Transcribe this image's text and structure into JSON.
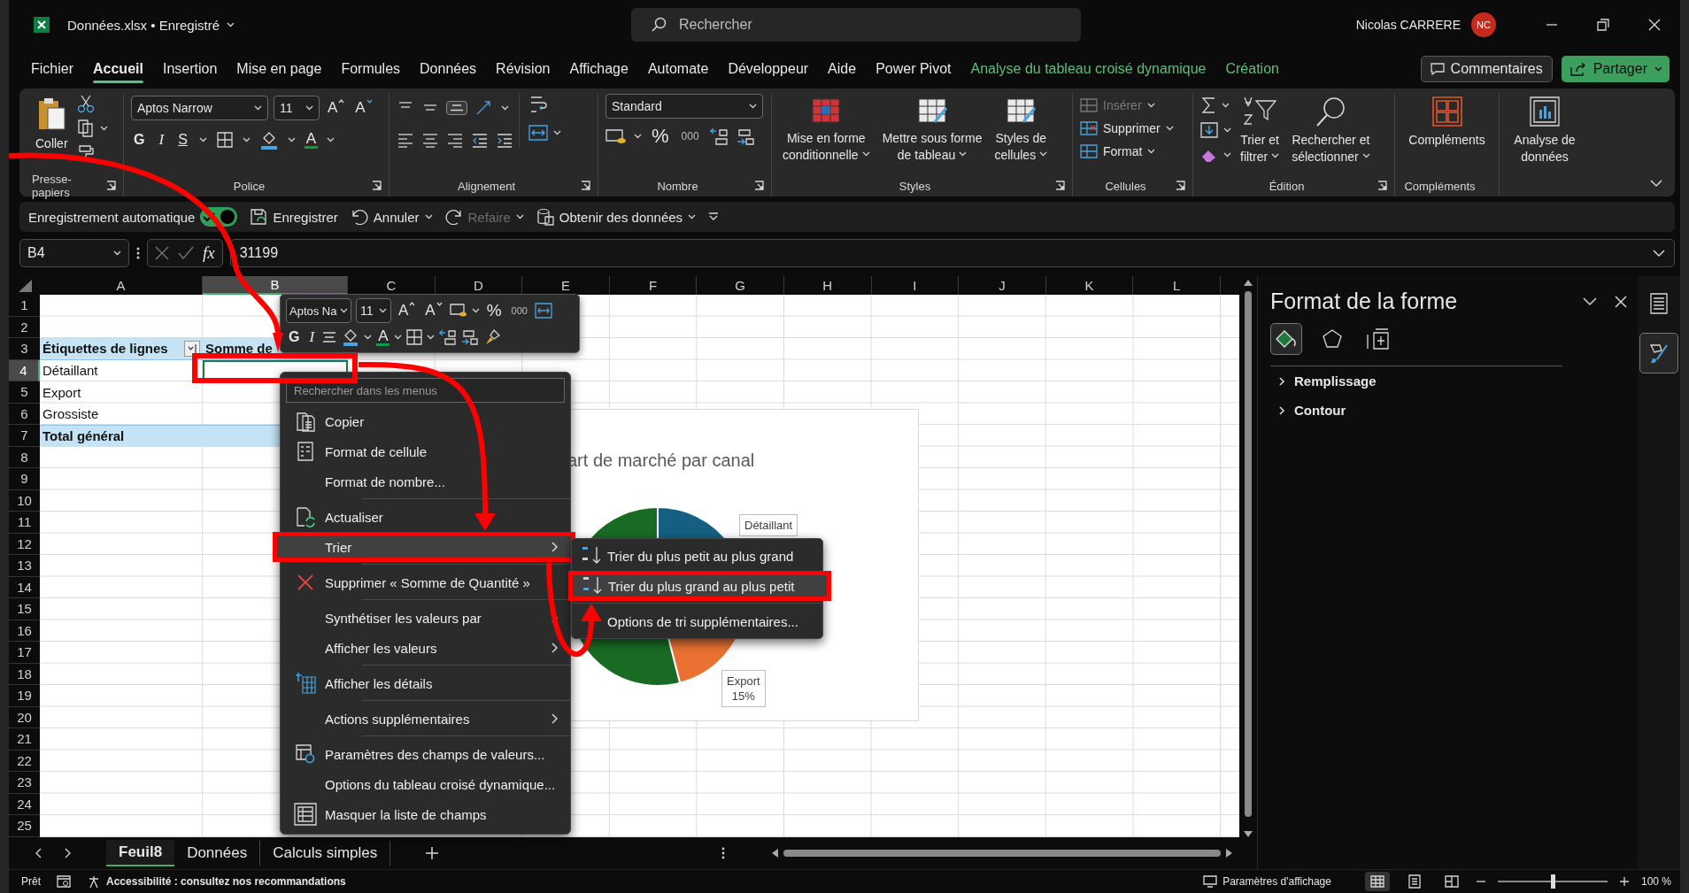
{
  "window": {
    "title": "Données.xlsx • Enregistré",
    "search": {
      "placeholder": "Rechercher"
    },
    "user": "Nicolas CARRERE",
    "avatar": "NC"
  },
  "menu_tabs": [
    {
      "label": "Fichier",
      "selected": false,
      "kind": "normal"
    },
    {
      "label": "Accueil",
      "selected": true,
      "kind": "normal"
    },
    {
      "label": "Insertion",
      "selected": false,
      "kind": "normal"
    },
    {
      "label": "Mise en page",
      "selected": false,
      "kind": "normal"
    },
    {
      "label": "Formules",
      "selected": false,
      "kind": "normal"
    },
    {
      "label": "Données",
      "selected": false,
      "kind": "normal"
    },
    {
      "label": "Révision",
      "selected": false,
      "kind": "normal"
    },
    {
      "label": "Affichage",
      "selected": false,
      "kind": "normal"
    },
    {
      "label": "Automate",
      "selected": false,
      "kind": "normal"
    },
    {
      "label": "Développeur",
      "selected": false,
      "kind": "normal"
    },
    {
      "label": "Aide",
      "selected": false,
      "kind": "normal"
    },
    {
      "label": "Power Pivot",
      "selected": false,
      "kind": "normal"
    },
    {
      "label": "Analyse du tableau croisé dynamique",
      "selected": false,
      "kind": "contextual"
    },
    {
      "label": "Création",
      "selected": false,
      "kind": "contextual"
    }
  ],
  "comments_button": "Commentaires",
  "share_button": "Partager",
  "ribbon": {
    "clipboard": {
      "label": "Presse-papiers",
      "paste": "Coller"
    },
    "font": {
      "label": "Police",
      "font_name": "Aptos Narrow",
      "font_size": "11",
      "grow": "A",
      "shrink": "A",
      "bold": "G",
      "italic": "I",
      "underline": "S",
      "font_color": "A"
    },
    "alignment": {
      "label": "Alignement"
    },
    "number": {
      "label": "Nombre",
      "format": "Standard",
      "percent": "%",
      "thousands": "000"
    },
    "styles": {
      "label": "Styles",
      "buttons": [
        {
          "lines": [
            "Mise en forme",
            "conditionnelle"
          ]
        },
        {
          "lines": [
            "Mettre sous forme",
            "de tableau"
          ]
        },
        {
          "lines": [
            "Styles de",
            "cellules"
          ]
        }
      ]
    },
    "cells": {
      "label": "Cellules",
      "items": [
        {
          "label": "Insérer",
          "disabled": true
        },
        {
          "label": "Supprimer",
          "disabled": false
        },
        {
          "label": "Format",
          "disabled": false
        }
      ]
    },
    "editing": {
      "label": "Édition",
      "sort_filter": [
        "Trier et",
        "filtrer"
      ],
      "find": [
        "Rechercher et",
        "sélectionner"
      ]
    },
    "addins": {
      "label": "Compléments",
      "button": "Compléments"
    },
    "analysis": {
      "button": [
        "Analyse de",
        "données"
      ]
    }
  },
  "quick_access": {
    "autosave": {
      "label": "Enregistrement automatique",
      "on": true
    },
    "save": "Enregistrer",
    "undo": "Annuler",
    "redo": {
      "label": "Refaire",
      "disabled": true
    },
    "get_data": "Obtenir des données"
  },
  "formula_bar": {
    "name_box": "B4",
    "fx": "fx",
    "value": "31199"
  },
  "sheet": {
    "columns": [
      {
        "label": "A",
        "selected": false
      },
      {
        "label": "B",
        "selected": true
      },
      {
        "label": "C",
        "selected": false
      },
      {
        "label": "D",
        "selected": false
      },
      {
        "label": "E",
        "selected": false
      },
      {
        "label": "F",
        "selected": false
      },
      {
        "label": "G",
        "selected": false
      },
      {
        "label": "H",
        "selected": false
      },
      {
        "label": "I",
        "selected": false
      },
      {
        "label": "J",
        "selected": false
      },
      {
        "label": "K",
        "selected": false
      },
      {
        "label": "L",
        "selected": false
      }
    ],
    "rows": [
      {
        "label": "1",
        "selected": false
      },
      {
        "label": "2",
        "selected": false
      },
      {
        "label": "3",
        "selected": false
      },
      {
        "label": "4",
        "selected": true
      },
      {
        "label": "5",
        "selected": false
      },
      {
        "label": "6",
        "selected": false
      },
      {
        "label": "7",
        "selected": false
      },
      {
        "label": "8",
        "selected": false
      },
      {
        "label": "9",
        "selected": false
      },
      {
        "label": "10",
        "selected": false
      },
      {
        "label": "11",
        "selected": false
      },
      {
        "label": "12",
        "selected": false
      },
      {
        "label": "13",
        "selected": false
      },
      {
        "label": "14",
        "selected": false
      },
      {
        "label": "15",
        "selected": false
      },
      {
        "label": "16",
        "selected": false
      },
      {
        "label": "17",
        "selected": false
      },
      {
        "label": "18",
        "selected": false
      },
      {
        "label": "19",
        "selected": false
      },
      {
        "label": "20",
        "selected": false
      },
      {
        "label": "21",
        "selected": false
      },
      {
        "label": "22",
        "selected": false
      },
      {
        "label": "23",
        "selected": false
      },
      {
        "label": "24",
        "selected": false
      },
      {
        "label": "25",
        "selected": false
      }
    ],
    "pivot": {
      "header": {
        "label": "Étiquettes de lignes",
        "value": "Somme de"
      },
      "rows": [
        {
          "label": "Détaillant",
          "selected": true,
          "kind": "item"
        },
        {
          "label": "Export",
          "selected": false,
          "kind": "item"
        },
        {
          "label": "Grossiste",
          "selected": false,
          "kind": "item"
        },
        {
          "label": "Total général",
          "selected": false,
          "kind": "total"
        }
      ]
    }
  },
  "sheet_tabs": [
    {
      "label": "Feuil8",
      "selected": true
    },
    {
      "label": "Données",
      "selected": false
    },
    {
      "label": "Calculs simples",
      "selected": false
    }
  ],
  "pane": {
    "title": "Format de la forme",
    "tabs": [
      {
        "kind": "fill",
        "selected": true
      },
      {
        "kind": "effects",
        "selected": false
      },
      {
        "kind": "size",
        "selected": false
      }
    ],
    "sections": [
      {
        "label": "Remplissage",
        "expanded": false
      },
      {
        "label": "Contour",
        "expanded": false
      }
    ],
    "side_buttons": [
      {
        "kind": "properties",
        "selected": false
      },
      {
        "kind": "format",
        "selected": true
      }
    ]
  },
  "status_bar": {
    "ready": "Prêt",
    "accessibility": "Accessibilité : consultez nos recommandations",
    "display_settings": "Paramètres d'affichage",
    "views": [
      {
        "kind": "normal",
        "selected": true
      },
      {
        "kind": "page-layout",
        "selected": false
      },
      {
        "kind": "page-break",
        "selected": false
      }
    ],
    "zoom": {
      "level": 0.5
    },
    "zoom_text": "100 %"
  },
  "mini_toolbar": {
    "font_name": "Aptos Na",
    "font_size": "11",
    "grow": "A",
    "shrink": "A",
    "percent": "%",
    "thousands": "000",
    "bold": "G",
    "italic": "I",
    "font_color": "A"
  },
  "context_menu": {
    "search": {
      "placeholder": "Rechercher dans les menus"
    },
    "items": [
      {
        "label": "Copier",
        "kind": "copy",
        "has_submenu": false,
        "separator_before": false,
        "selected": false
      },
      {
        "label": "Format de cellule",
        "kind": "format-cells",
        "has_submenu": false,
        "separator_before": false,
        "selected": false
      },
      {
        "label": "Format de nombre...",
        "kind": "plain",
        "has_submenu": false,
        "separator_before": false,
        "selected": false
      },
      {
        "label": "Actualiser",
        "kind": "refresh",
        "has_submenu": false,
        "separator_before": true,
        "selected": false
      },
      {
        "label": "Trier",
        "kind": "plain",
        "has_submenu": true,
        "separator_before": false,
        "selected": true
      },
      {
        "label": "Supprimer « Somme de Quantité »",
        "kind": "delete",
        "has_submenu": false,
        "separator_before": true,
        "selected": false
      },
      {
        "label": "Synthétiser les valeurs par",
        "kind": "plain",
        "has_submenu": true,
        "separator_before": true,
        "selected": false
      },
      {
        "label": "Afficher les valeurs",
        "kind": "plain",
        "has_submenu": true,
        "separator_before": false,
        "selected": false
      },
      {
        "label": "Afficher les détails",
        "kind": "details",
        "has_submenu": false,
        "separator_before": true,
        "selected": false
      },
      {
        "label": "Actions supplémentaires",
        "kind": "plain",
        "has_submenu": true,
        "separator_before": true,
        "selected": false
      },
      {
        "label": "Paramètres des champs de valeurs...",
        "kind": "field-settings",
        "has_submenu": false,
        "separator_before": true,
        "selected": false
      },
      {
        "label": "Options du tableau croisé dynamique...",
        "kind": "plain",
        "has_submenu": false,
        "separator_before": false,
        "selected": false
      },
      {
        "label": "Masquer la liste de champs",
        "kind": "field-list",
        "has_submenu": false,
        "separator_before": false,
        "selected": false
      }
    ]
  },
  "submenu": {
    "items": [
      {
        "label": "Trier du plus petit au plus grand",
        "kind": "sort-asc",
        "separator_before": false,
        "selected": false
      },
      {
        "label": "Trier du plus grand au plus petit",
        "kind": "sort-desc",
        "separator_before": false,
        "selected": true
      },
      {
        "label": "Options de tri supplémentaires...",
        "kind": "plain",
        "separator_before": true,
        "selected": false
      }
    ]
  },
  "chart": {
    "title": "art de marché par canal",
    "labels": [
      {
        "lines": [
          "Détaillant"
        ]
      },
      {
        "lines": [
          "Export",
          "15%"
        ]
      }
    ]
  }
}
